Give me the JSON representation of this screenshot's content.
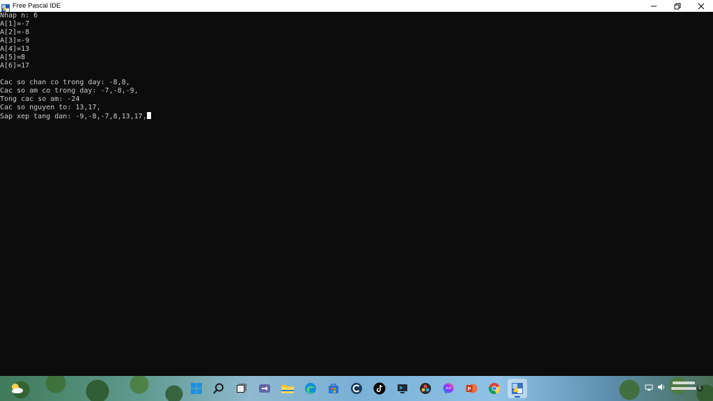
{
  "window": {
    "title": "Free Pascal IDE",
    "controls": {
      "minimize_icon": "minimize-icon",
      "restore_icon": "restore-icon",
      "close_icon": "close-icon"
    }
  },
  "console": {
    "lines": [
      "Nhap n: 6",
      "A[1]=-7",
      "A[2]=-8",
      "A[3]=-9",
      "A[4]=13",
      "A[5]=8",
      "A[6]=17",
      "",
      "Cac so chan co trong day: -8,8,",
      "Cac so am co trong day: -7,-8,-9,",
      "Tong cac so am: -24",
      "Cac so nguyen to: 13,17,",
      "Sap xep tang dan: -9,-8,-7,8,13,17,"
    ]
  },
  "taskbar": {
    "apps": [
      {
        "name": "weather-icon"
      },
      {
        "name": "start-icon"
      },
      {
        "name": "search-icon"
      },
      {
        "name": "task-view-icon"
      },
      {
        "name": "teams-chat-icon"
      },
      {
        "name": "file-explorer-icon"
      },
      {
        "name": "edge-icon"
      },
      {
        "name": "store-icon"
      },
      {
        "name": "ccleaner-icon"
      },
      {
        "name": "tiktok-icon"
      },
      {
        "name": "terminal-app-icon"
      },
      {
        "name": "davinci-icon"
      },
      {
        "name": "messenger-icon"
      },
      {
        "name": "powerpoint-icon"
      },
      {
        "name": "chrome-icon"
      },
      {
        "name": "free-pascal-icon"
      }
    ],
    "notification_count": "1"
  },
  "colors": {
    "console_bg": "#0c0c0c",
    "console_text": "#cccccc",
    "titlebar_bg": "#ffffff"
  }
}
